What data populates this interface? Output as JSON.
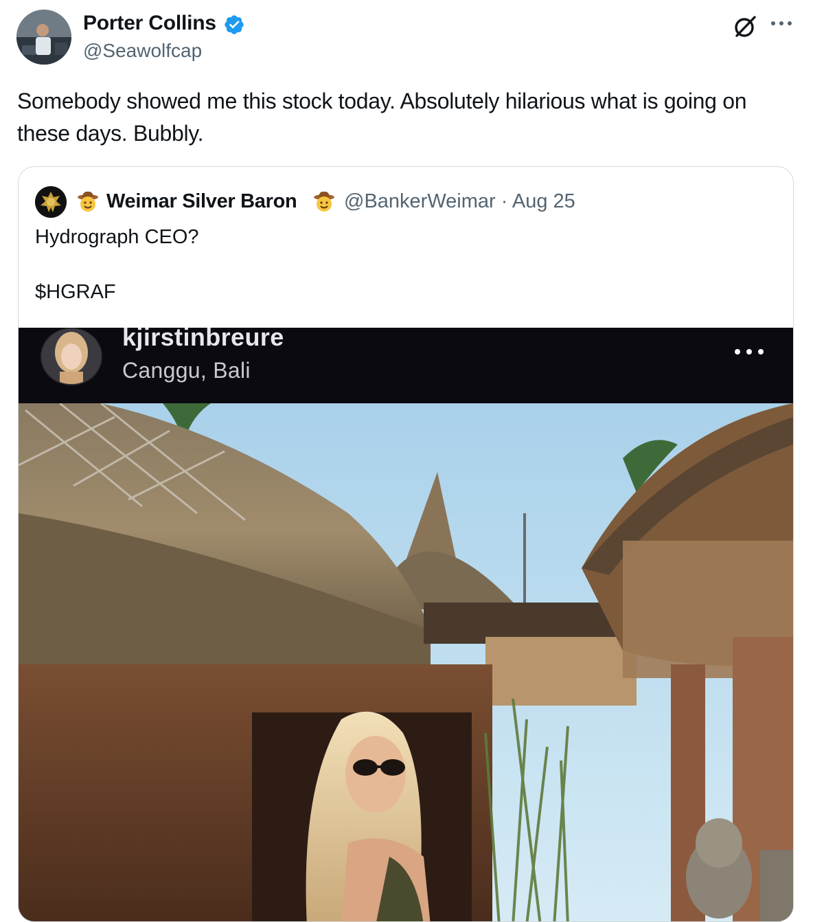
{
  "tweet": {
    "author_name": "Porter Collins",
    "handle": "@Seawolfcap",
    "text": "Somebody showed me this stock today. Absolutely hilarious what is going on these days. Bubbly.",
    "more_icon": "more-horizontal-icon",
    "grok_icon": "grok-icon"
  },
  "quote": {
    "author_name": "Weimar Silver Baron",
    "handle_date": "@BankerWeimar · Aug 25",
    "text": "Hydrograph CEO?\n\n$HGRAF",
    "emoji": "cowboy-face"
  },
  "media": {
    "ig_username": "kjirstinbreure",
    "ig_location": "Canggu, Bali",
    "ig_more": "•••"
  },
  "colors": {
    "verified": "#1d9bf0",
    "secondary_text": "#536471",
    "border": "#cfd9de",
    "sky": "#a9d1ea"
  }
}
